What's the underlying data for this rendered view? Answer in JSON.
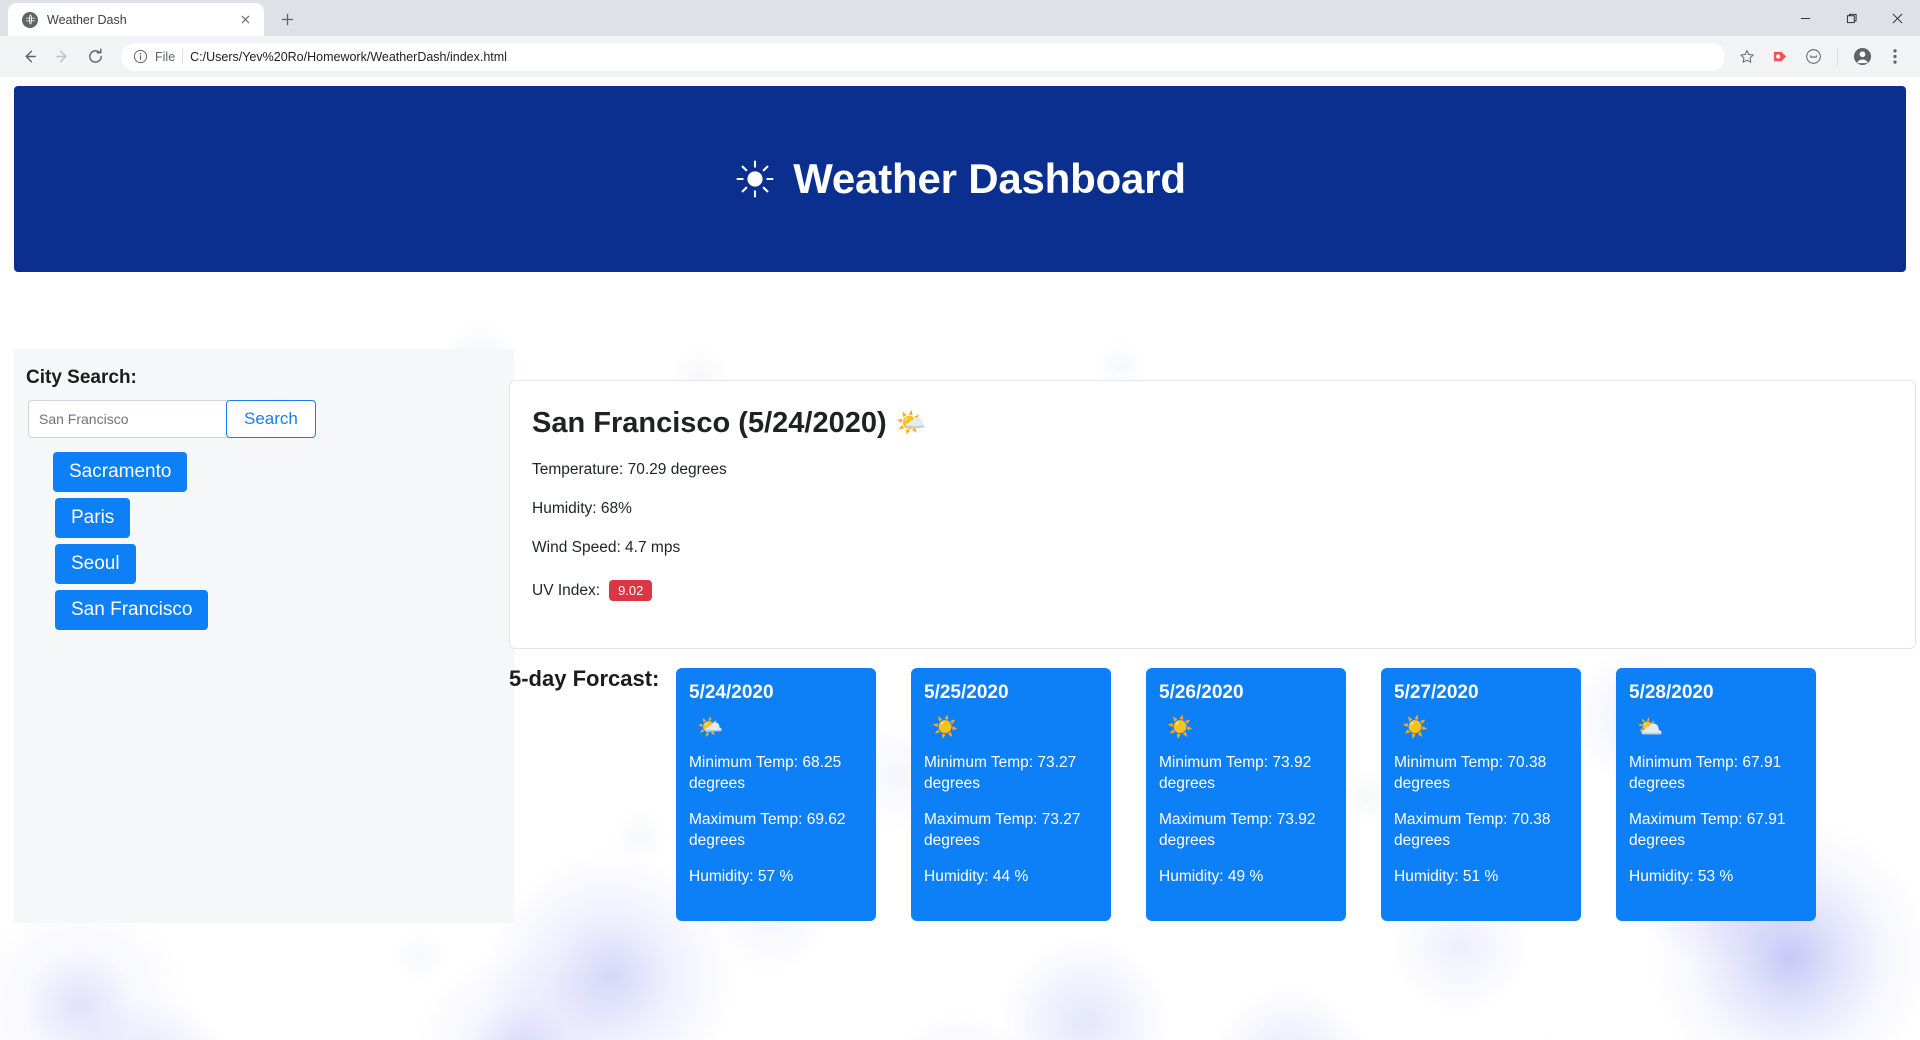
{
  "browser": {
    "tab": {
      "title": "Weather Dash",
      "favicon_icon": "globe-icon",
      "close_icon": "close-icon"
    },
    "new_tab_label": "+",
    "window_controls": {
      "minimize": "minimize-icon",
      "maximize": "maximize-icon",
      "close": "close-icon"
    },
    "nav": {
      "back": "back-arrow-icon",
      "forward": "forward-arrow-icon",
      "reload": "reload-icon"
    },
    "omnibox": {
      "info_icon": "info-circle-icon",
      "scheme_label": "File",
      "url": "C:/Users/Yev%20Ro/Homework/WeatherDash/index.html"
    },
    "toolbar_icons": [
      "star-icon",
      "extension-icon",
      "profile-circle-icon",
      "account-icon",
      "menu-dots-icon"
    ]
  },
  "app": {
    "header": {
      "title": "Weather Dashboard",
      "icon": "sun-icon",
      "background_color": "#0b2f8f"
    },
    "sidebar": {
      "label": "City Search:",
      "search": {
        "value": "San Francisco",
        "placeholder": "San Francisco"
      },
      "search_button": "Search",
      "cities": [
        "Sacramento",
        "Paris",
        "Seoul",
        "San Francisco"
      ],
      "city_button_color": "#0d7ff7"
    },
    "current": {
      "title": "San Francisco (5/24/2020)",
      "icon_emoji": "🌤️",
      "icon_name": "sun-behind-cloud-icon",
      "temperature": "Temperature: 70.29 degrees",
      "humidity": "Humidity: 68%",
      "wind": "Wind Speed: 4.7 mps",
      "uv_label": "UV Index:",
      "uv_value": "9.02",
      "uv_badge_color": "#dc3545"
    },
    "forecast": {
      "heading": "5-day Forcast:",
      "days": [
        {
          "date": "5/24/2020",
          "icon_emoji": "🌤️",
          "icon_name": "sun-behind-cloud-icon",
          "min_temp": "Minimum Temp: 68.25 degrees",
          "max_temp": "Maximum Temp: 69.62 degrees",
          "humidity": "Humidity: 57 %"
        },
        {
          "date": "5/25/2020",
          "icon_emoji": "☀️",
          "icon_name": "sun-icon",
          "min_temp": "Minimum Temp: 73.27 degrees",
          "max_temp": "Maximum Temp: 73.27 degrees",
          "humidity": "Humidity: 44 %"
        },
        {
          "date": "5/26/2020",
          "icon_emoji": "☀️",
          "icon_name": "sun-icon",
          "min_temp": "Minimum Temp: 73.92 degrees",
          "max_temp": "Maximum Temp: 73.92 degrees",
          "humidity": "Humidity: 49 %"
        },
        {
          "date": "5/27/2020",
          "icon_emoji": "☀️",
          "icon_name": "sun-icon",
          "min_temp": "Minimum Temp: 70.38 degrees",
          "max_temp": "Maximum Temp: 70.38 degrees",
          "humidity": "Humidity: 51 %"
        },
        {
          "date": "5/28/2020",
          "icon_emoji": "⛅",
          "icon_name": "cloud-icon",
          "min_temp": "Minimum Temp: 67.91 degrees",
          "max_temp": "Maximum Temp: 67.91 degrees",
          "humidity": "Humidity: 53 %"
        }
      ]
    }
  }
}
